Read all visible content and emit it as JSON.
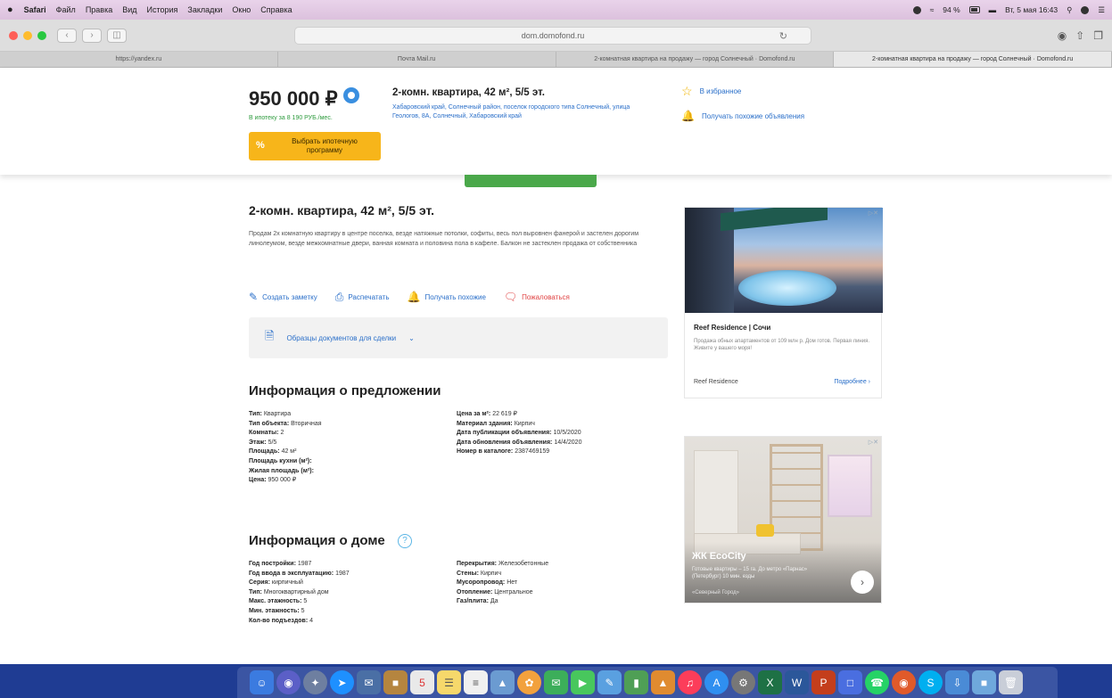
{
  "menubar": {
    "apple": "",
    "items": [
      "Safari",
      "Файл",
      "Правка",
      "Вид",
      "История",
      "Закладки",
      "Окно",
      "Справка"
    ],
    "status": "94 %",
    "datetime": "Вт, 5 мая 16:43"
  },
  "toolbar": {
    "url": "dom.domofond.ru"
  },
  "tabs": [
    "https://yandex.ru",
    "Почта Mail.ru",
    "2-комнатная квартира на продажу — город Солнечный · Domofond.ru",
    "2-комнатная квартира на продажу — город Солнечный · Domofond.ru"
  ],
  "sticky": {
    "price": "950 000 ₽",
    "mortgage_note": "В ипотеку за 8 190 РУБ./мес.",
    "mortgage_button": "Выбрать ипотечную программу",
    "title": "2-комн. квартира, 42 м², 5/5 эт.",
    "address": "Хабаровский край, Солнечный район, поселок городского типа Солнечный, улица Геологов, 8А, Солнечный, Хабаровский край",
    "favorites": "В избранное",
    "similar": "Получать похожие объявления"
  },
  "main": {
    "title": "2-комн. квартира, 42 м², 5/5 эт.",
    "description": "Продам 2х комнатную квартиру в центре поселка, везде натяжные потолки, софиты, весь пол выровнен фанерой и застелен дорогим линолеумом, везде межкомнатные двери, ванная комната и половина пола в кафеле. Балкон не застеклен продажа от собственника",
    "actions": {
      "note": "Создать заметку",
      "print": "Распечатать",
      "similar": "Получать похожие",
      "complain": "Пожаловаться"
    },
    "docs": "Образцы документов для сделки"
  },
  "offer": {
    "heading": "Информация о предложении",
    "left": [
      {
        "k": "Тип:",
        "v": "Квартира"
      },
      {
        "k": "Тип объекта:",
        "v": "Вторичная"
      },
      {
        "k": "Комнаты:",
        "v": "2"
      },
      {
        "k": "Этаж:",
        "v": "5/5"
      },
      {
        "k": "Площадь:",
        "v": "42 м²"
      },
      {
        "k": "Площадь кухни (м²):",
        "v": ""
      },
      {
        "k": "Жилая площадь (м²):",
        "v": ""
      },
      {
        "k": "Цена:",
        "v": "950 000 ₽"
      }
    ],
    "right": [
      {
        "k": "Цена за м²:",
        "v": "22 619 ₽"
      },
      {
        "k": "Материал здания:",
        "v": "Кирпич"
      },
      {
        "k": "Дата публикации объявления:",
        "v": "10/5/2020"
      },
      {
        "k": "Дата обновления объявления:",
        "v": "14/4/2020"
      },
      {
        "k": "Номер в каталоге:",
        "v": "2387469159"
      }
    ]
  },
  "house": {
    "heading": "Информация о доме",
    "left": [
      {
        "k": "Год постройки:",
        "v": "1987"
      },
      {
        "k": "Год ввода в эксплуатацию:",
        "v": "1987"
      },
      {
        "k": "Серия:",
        "v": "кирпичный"
      },
      {
        "k": "Тип:",
        "v": "Многоквартирный дом"
      },
      {
        "k": "Макс. этажность:",
        "v": "5"
      },
      {
        "k": "Мин. этажность:",
        "v": "5"
      },
      {
        "k": "Кол-во подъездов:",
        "v": "4"
      }
    ],
    "right": [
      {
        "k": "Перекрытия:",
        "v": "Железобетонные"
      },
      {
        "k": "Стены:",
        "v": "Кирпич"
      },
      {
        "k": "Мусоропровод:",
        "v": "Нет"
      },
      {
        "k": "Отопление:",
        "v": "Центральное"
      },
      {
        "k": "Газ/плита:",
        "v": "Да"
      }
    ]
  },
  "ads": {
    "ad1": {
      "title": "Reef Residence | Сочи",
      "text": "Продажа обных апартаментов от 109 млн р. Дом готов. Первая линия. Живите у вашего моря!",
      "brand": "Reef Residence",
      "more": "Подробнее"
    },
    "ad2": {
      "title": "ЖК EcoCity",
      "text": "Готовые квартиры – 15 га. До метро «Парнас» (Петербург) 10 мин. езды",
      "source": "«Северный Город»"
    }
  },
  "colors": {
    "link": "#2a6fc9",
    "green": "#2e9b3e",
    "mortgage_button": "#f7b51a",
    "dock": "#1f3c93"
  }
}
